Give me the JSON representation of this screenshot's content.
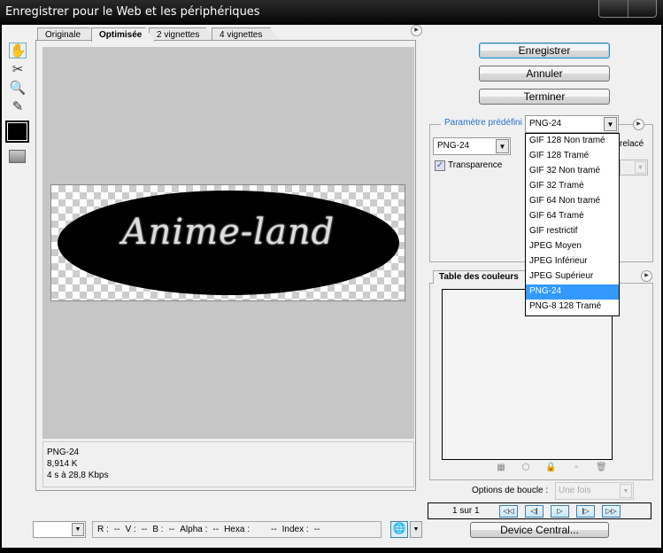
{
  "window": {
    "title": "Enregistrer pour le Web et les périphériques"
  },
  "tabs": [
    {
      "label": "Originale"
    },
    {
      "label": "Optimisée",
      "active": true
    },
    {
      "label": "2 vignettes"
    },
    {
      "label": "4 vignettes"
    }
  ],
  "tools": [
    {
      "icon": "hand-icon"
    },
    {
      "icon": "slice-select-icon"
    },
    {
      "icon": "zoom-icon"
    },
    {
      "icon": "eyedropper-icon"
    }
  ],
  "eyedropper_color": "#000000",
  "preview": {
    "logo_text": "Anime-land",
    "info": {
      "format": "PNG-24",
      "size": "8,914 K",
      "time": "4 s à 28,8 Kbps"
    }
  },
  "buttons": {
    "save": "Enregistrer",
    "cancel": "Annuler",
    "done": "Terminer",
    "device_central": "Device Central..."
  },
  "settings": {
    "preset_label": "Paramètre prédéfini :",
    "preset_value": "PNG-24",
    "format_value": "PNG-24",
    "transparency_label": "Transparence",
    "transparency_checked": true,
    "interlace_label": "relacé",
    "preset_options": [
      "GIF 128 Non tramé",
      "GIF 128 Tramé",
      "GIF 32 Non tramé",
      "GIF 32 Tramé",
      "GIF 64 Non tramé",
      "GIF 64 Tramé",
      "GIF restrictif",
      "JPEG  Moyen",
      "JPEG Inférieur",
      "JPEG Supérieur",
      "PNG-24",
      "PNG-8 128 Tramé"
    ],
    "selected_option": "PNG-24"
  },
  "color_table": {
    "tab_label": "Table des couleurs"
  },
  "loop": {
    "label": "Options de boucle :",
    "value": "Une fois"
  },
  "animation": {
    "frame_label": "1 sur 1"
  },
  "status": {
    "r_label": "R :",
    "r": "--",
    "v_label": "V :",
    "v": "--",
    "b_label": "B :",
    "b": "--",
    "alpha_label": "Alpha :",
    "alpha": "--",
    "hexa_label": "Hexa :",
    "hexa": "--",
    "index_label": "Index :",
    "index": "--"
  },
  "colors": {
    "highlight": "#3399ff",
    "titlebar": "#000000",
    "panel": "#f0f0f0",
    "canvas": "#c6c6c6"
  }
}
